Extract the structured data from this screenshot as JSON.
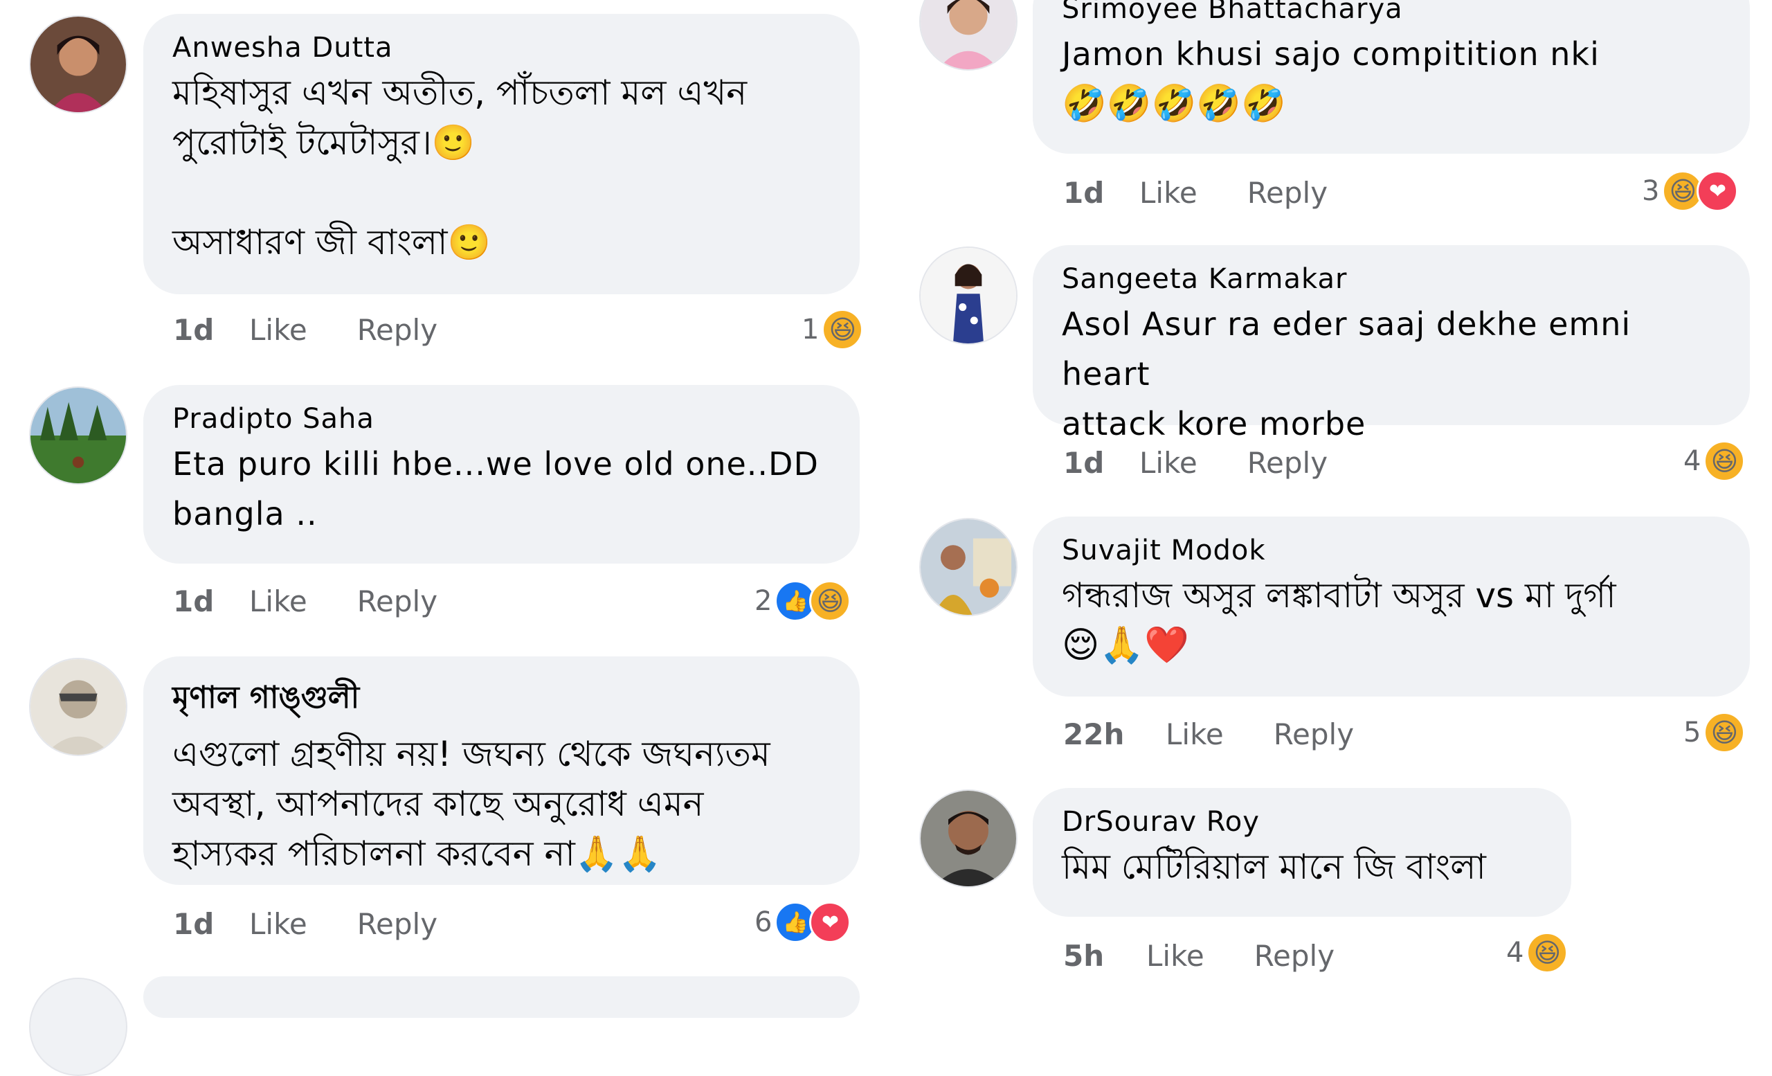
{
  "colors": {
    "bubble": "#f0f2f5",
    "meta": "#65676b",
    "like": "#1877f2",
    "love": "#f33e58",
    "haha": "#f7b125"
  },
  "labels": {
    "like": "Like",
    "reply": "Reply"
  },
  "reaction_icons": {
    "haha": "😆",
    "like": "👍",
    "love": "❤"
  },
  "left_column": [
    {
      "author": "Anwesha Dutta",
      "text": "মহিষাসুর এখন অতীত, পাঁচতলা মল এখন\nপুরোটাই টমেটাসুর।🙂\n\nঅসাধারণ জী বাংলা🙂",
      "time": "1d",
      "reaction_count": "1",
      "reactions": [
        "haha-icon"
      ]
    },
    {
      "author": "Pradipto Saha",
      "text": "Eta puro killi hbe...we love old one..DD\nbangla ..",
      "time": "1d",
      "reaction_count": "2",
      "reactions": [
        "like-icon",
        "haha-icon"
      ]
    },
    {
      "author": "মৃণাল গাঙ্গুলী",
      "text": "এগুলো গ্রহণীয় নয়! জঘন্য থেকে জঘন্যতম\nঅবস্থা, আপনাদের কাছে অনুরোধ এমন\nহাস্যকর পরিচালনা করবেন না🙏🙏",
      "time": "1d",
      "reaction_count": "6",
      "reactions": [
        "like-icon",
        "love-icon"
      ]
    }
  ],
  "right_column": [
    {
      "author": "Srimoyee Bhattacharya",
      "text": "Jamon khusi sajo compitition nki",
      "emojis": "🤣🤣🤣🤣🤣",
      "time": "1d",
      "reaction_count": "3",
      "reactions": [
        "haha-icon",
        "love-icon"
      ]
    },
    {
      "author": "Sangeeta Karmakar",
      "text": "Asol Asur ra eder saaj dekhe emni heart\nattack kore morbe",
      "time": "1d",
      "reaction_count": "4",
      "reactions": [
        "haha-icon"
      ]
    },
    {
      "author": "Suvajit Modok",
      "text": "গন্ধরাজ অসুর লঙ্কাবাটা অসুর vs মা দুর্গা",
      "emojis": "😌🙏❤️",
      "time": "22h",
      "reaction_count": "5",
      "reactions": [
        "haha-icon"
      ]
    },
    {
      "author": "DrSourav Roy",
      "text": "মিম মেটিরিয়াল মানে জি বাংলা",
      "time": "5h",
      "reaction_count": "4",
      "reactions": [
        "haha-icon"
      ]
    }
  ]
}
